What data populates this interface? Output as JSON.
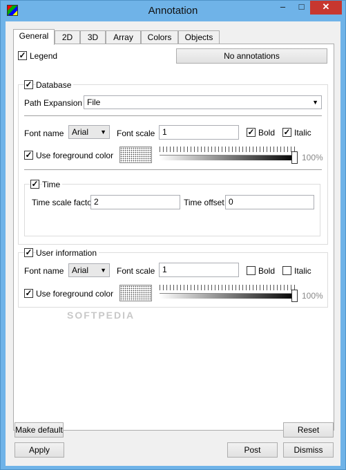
{
  "window": {
    "title": "Annotation",
    "minimize_glyph": "–",
    "maximize_glyph": "□",
    "close_glyph": "✕"
  },
  "tabs": [
    {
      "label": "General",
      "active": true
    },
    {
      "label": "2D"
    },
    {
      "label": "3D"
    },
    {
      "label": "Array"
    },
    {
      "label": "Colors"
    },
    {
      "label": "Objects"
    }
  ],
  "legend": {
    "label": "Legend",
    "checked": true,
    "mark": "✓"
  },
  "no_annotations_label": "No annotations",
  "database": {
    "label": "Database",
    "checked": true,
    "mark": "✓",
    "path_expansion_label": "Path Expansion",
    "path_expansion_value": "File",
    "font_name_label": "Font name",
    "font_name_value": "Arial",
    "font_scale_label": "Font scale",
    "font_scale_value": "1",
    "bold": {
      "label": "Bold",
      "checked": true,
      "mark": "✓"
    },
    "italic": {
      "label": "Italic",
      "checked": true,
      "mark": "✓"
    },
    "use_fg": {
      "label": "Use foreground color",
      "checked": true,
      "mark": "✓"
    },
    "opacity": 1.0,
    "opacity_label": "100%",
    "time": {
      "label": "Time",
      "checked": true,
      "mark": "✓",
      "scale_label": "Time scale factor",
      "scale_value": "2",
      "offset_label": "Time offset",
      "offset_value": "0"
    }
  },
  "user_info": {
    "label": "User information",
    "checked": true,
    "mark": "✓",
    "font_name_label": "Font name",
    "font_name_value": "Arial",
    "font_scale_label": "Font scale",
    "font_scale_value": "1",
    "bold": {
      "label": "Bold",
      "checked": false,
      "mark": ""
    },
    "italic": {
      "label": "Italic",
      "checked": false,
      "mark": ""
    },
    "use_fg": {
      "label": "Use foreground color",
      "checked": true,
      "mark": "✓"
    },
    "opacity": 1.0,
    "opacity_label": "100%"
  },
  "watermark": "SOFTPEDIA",
  "buttons": {
    "make_default": "Make default",
    "reset": "Reset",
    "apply": "Apply",
    "post": "Post",
    "dismiss": "Dismiss"
  },
  "icons": {
    "app": "app-icon",
    "check": "check-icon",
    "dropdown": "chevron-down-icon"
  },
  "colors": {
    "titlebar": "#6fb3e8",
    "close": "#c7372f"
  }
}
